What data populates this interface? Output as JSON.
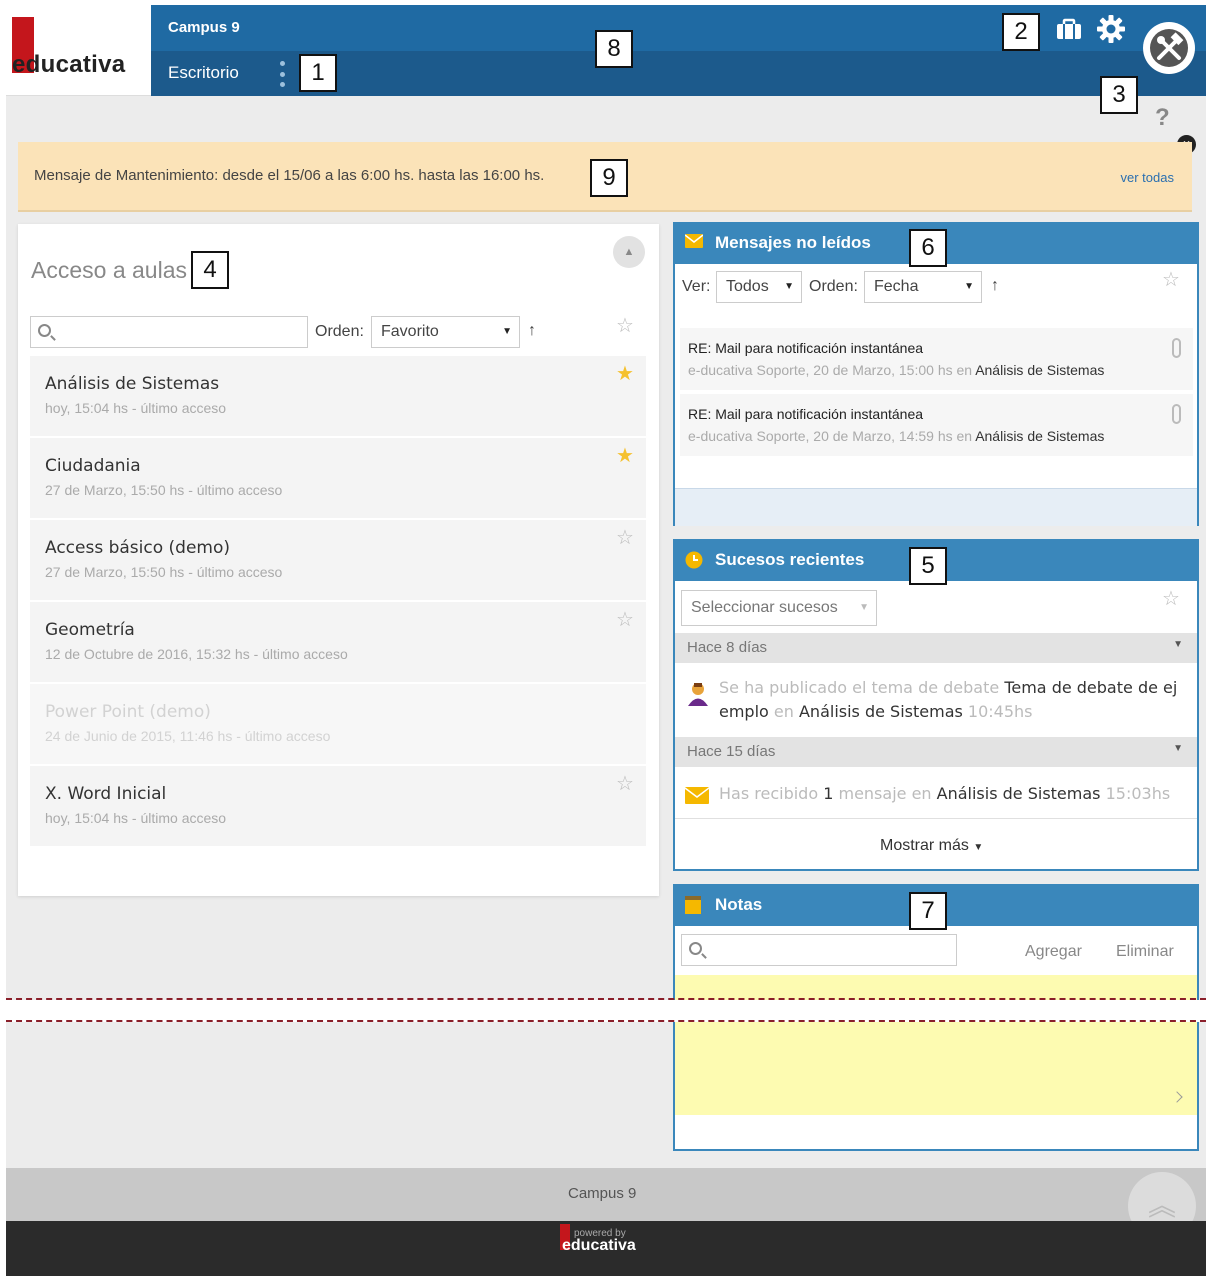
{
  "header": {
    "campus": "Campus 9",
    "section": "Escritorio",
    "logo": "educativa"
  },
  "callouts": [
    "1",
    "2",
    "3",
    "4",
    "5",
    "6",
    "7",
    "8",
    "9"
  ],
  "banner": {
    "text": "Mensaje de Mantenimiento: desde el 15/06 a las 6:00 hs. hasta las 16:00 hs.",
    "link": "ver todas"
  },
  "aulas": {
    "title": "Acceso a aulas",
    "orden_label": "Orden:",
    "orden_value": "Favorito",
    "courses": [
      {
        "name": "Análisis de Sistemas",
        "sub": "hoy, 15:04 hs - último acceso",
        "favorite": true
      },
      {
        "name": "Ciudadania",
        "sub": "27 de Marzo, 15:50 hs - último acceso",
        "favorite": true
      },
      {
        "name": "Access básico (demo)",
        "sub": "27 de Marzo, 15:50 hs - último acceso",
        "favorite": false
      },
      {
        "name": "Geometría",
        "sub": "12 de Octubre de 2016, 15:32 hs - último acceso",
        "favorite": false
      },
      {
        "name": "Power Point (demo)",
        "sub": "24 de Junio de 2015, 11:46 hs - último acceso",
        "favorite": false
      },
      {
        "name": "X. Word Inicial",
        "sub": "hoy, 15:04 hs - último acceso",
        "favorite": false
      }
    ]
  },
  "mensajes": {
    "title": "Mensajes no leídos",
    "ver_label": "Ver:",
    "ver_value": "Todos",
    "orden_label": "Orden:",
    "orden_value": "Fecha",
    "items": [
      {
        "subject": "RE: Mail para notificación instantánea",
        "meta": "e-ducativa Soporte, 20 de Marzo, 15:00 hs en ",
        "course": "Análisis de Sistemas"
      },
      {
        "subject": "RE: Mail para notificación instantánea",
        "meta": "e-ducativa Soporte, 20 de Marzo, 14:59 hs en ",
        "course": "Análisis de Sistemas"
      }
    ]
  },
  "sucesos": {
    "title": "Sucesos recientes",
    "select": "Seleccionar sucesos",
    "group1": "Hace 8 días",
    "ev1_a": "Se ha publicado el tema de debate ",
    "ev1_b": "Tema de debate de ej",
    "ev1_c": "emplo",
    "ev1_d": " en ",
    "ev1_e": "Análisis de Sistemas",
    "ev1_f": " 10:45hs",
    "group2": "Hace 15 días",
    "ev2_a": "Has recibido ",
    "ev2_b": "1",
    "ev2_c": " mensaje en ",
    "ev2_d": "Análisis de Sistemas",
    "ev2_e": " 15:03hs",
    "more": "Mostrar más"
  },
  "notas": {
    "title": "Notas",
    "agregar": "Agregar",
    "eliminar": "Eliminar"
  },
  "footer": {
    "campus": "Campus 9",
    "powered": "powered by",
    "brand": "educativa"
  },
  "colors": {
    "header_blue": "#1f6aa3",
    "panel_blue": "#3a87bb",
    "banner": "#fbe3b8",
    "notes_yellow": "#fdfbb1",
    "star": "#f5c12e",
    "logo_red": "#c4161c"
  }
}
